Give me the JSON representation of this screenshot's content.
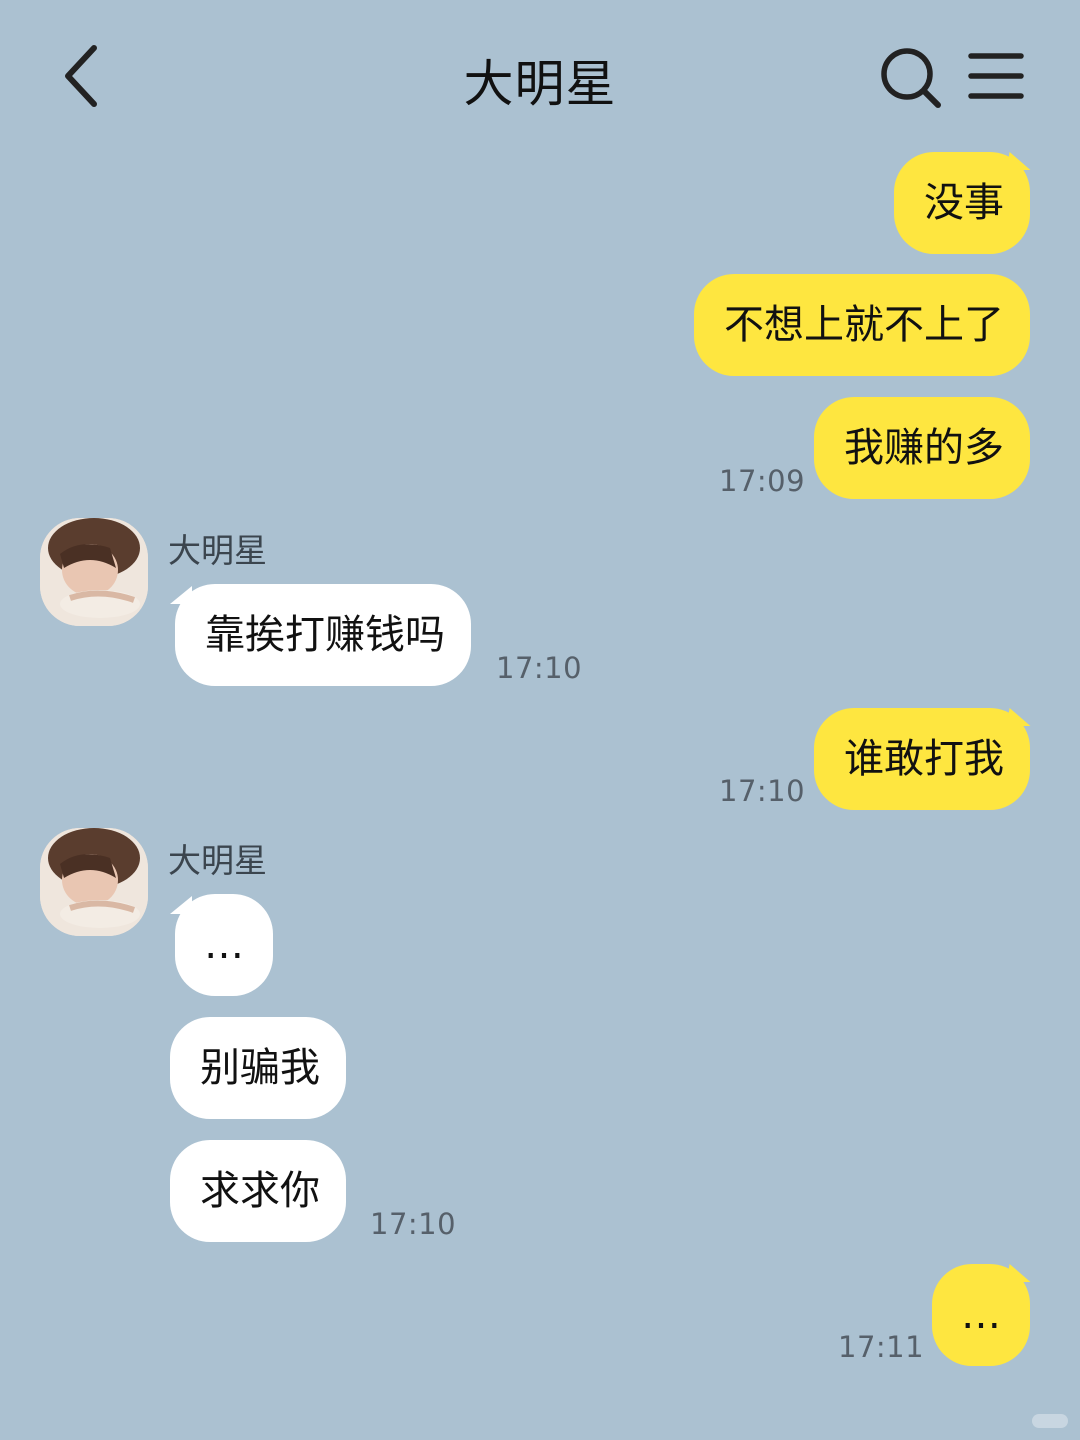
{
  "header": {
    "title": "大明星",
    "back_icon": "chevron-left-icon",
    "search_icon": "search-icon",
    "menu_icon": "menu-icon"
  },
  "colors": {
    "background": "#abc1d1",
    "my_bubble": "#fee640",
    "their_bubble": "#ffffff"
  },
  "messages": [
    {
      "text": "没事"
    },
    {
      "text": "不想上就不上了"
    },
    {
      "text": "我赚的多",
      "time": "17:09"
    },
    {
      "sender": "大明星",
      "text": "靠挨打赚钱吗",
      "time": "17:10"
    },
    {
      "text": "谁敢打我",
      "time": "17:10"
    },
    {
      "sender": "大明星",
      "text": "…"
    },
    {
      "text": "别骗我"
    },
    {
      "text": "求求你",
      "time": "17:10"
    },
    {
      "text": "…",
      "time": "17:11"
    }
  ]
}
